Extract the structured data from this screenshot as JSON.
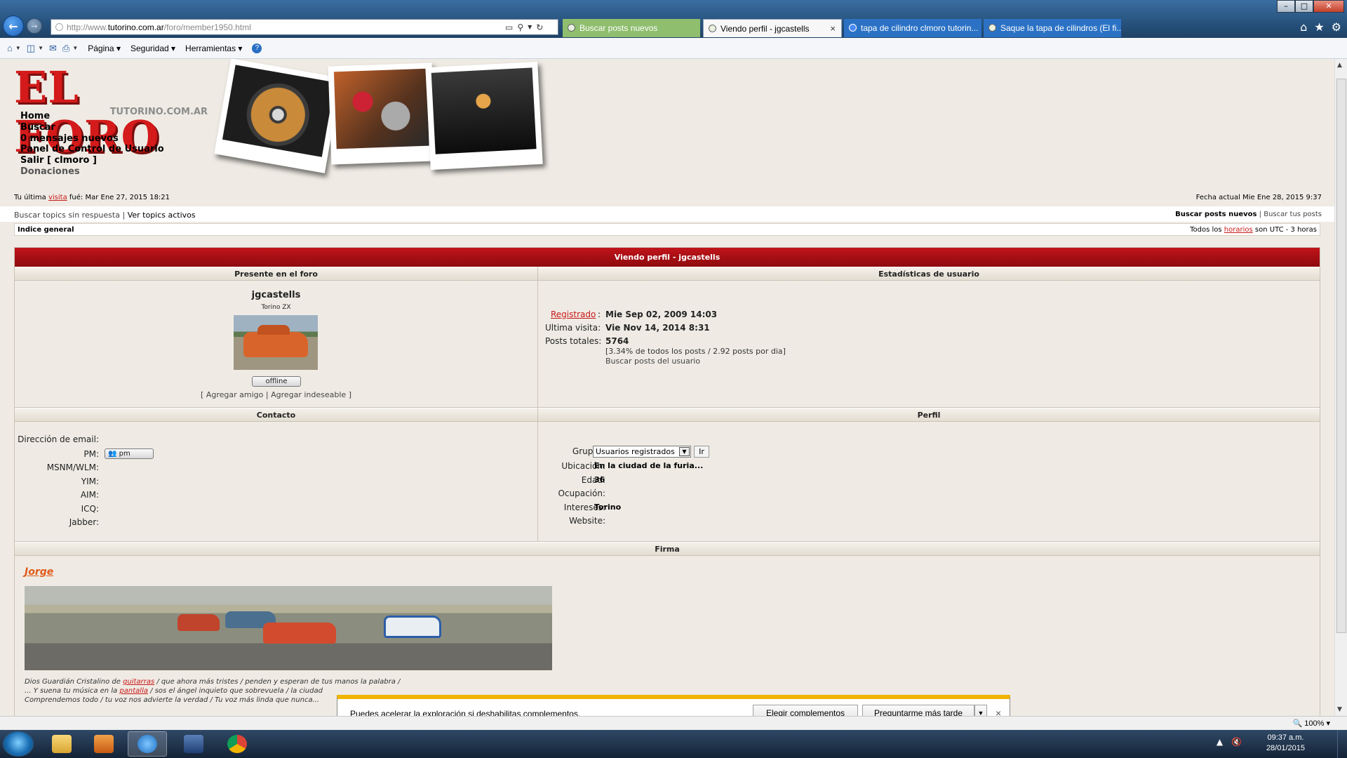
{
  "browser": {
    "address": {
      "prefix": "http://www.",
      "domain": "tutorino.com.ar",
      "path": "/foro/member1950.html"
    },
    "tabs": [
      {
        "label": "Buscar posts nuevos"
      },
      {
        "label": "Viendo perfil - jgcastells",
        "close": "×"
      },
      {
        "label": "tapa de cilindro clmoro tutorin..."
      },
      {
        "label": "Saque la tapa de cilindros (El fi..."
      }
    ],
    "command_bar": {
      "page": "Página",
      "safety": "Seguridad",
      "tools": "Herramientas"
    },
    "window_buttons": {
      "minimize": "–",
      "maximize": "□",
      "close": "✕"
    },
    "zoom": "100%"
  },
  "site": {
    "logo_main": "EL FORO",
    "logo_sub": "TUTORINO.COM.AR",
    "nav": [
      "Home",
      "Buscar",
      "0 mensajes nuevos",
      "Panel de Control de Usuario",
      "Salir [ clmoro ]",
      "Donaciones"
    ],
    "last_visit_prefix": "Tu última",
    "last_visit_link": "visita",
    "last_visit_suffix": "fué: Mar Ene 27, 2015 18:21",
    "current_date": "Fecha actual Mie Ene 28, 2015 9:37",
    "links_left_1": "Buscar topics sin respuesta",
    "links_sep": "|",
    "links_left_2": "Ver topics activos",
    "links_right_1": "Buscar posts nuevos",
    "links_right_2": "Buscar tus posts",
    "index_label": "Indice general",
    "tz_prefix": "Todos los",
    "tz_link": "horarios",
    "tz_suffix": "son UTC - 3 horas"
  },
  "profile": {
    "header": "Viendo perfil - jgcastells",
    "sections": {
      "present": "Presente en el foro",
      "stats": "Estadísticas de usuario",
      "contact": "Contacto",
      "profile": "Perfil",
      "signature": "Firma"
    },
    "username": "jgcastells",
    "rank": "Torino ZX",
    "status_badge": "offline",
    "friend_links": {
      "open": "[",
      "add_friend": "Agregar amigo",
      "sep": "|",
      "add_foe": "Agregar indeseable",
      "close": "]"
    },
    "stats": {
      "registered_label": "Registrado",
      "registered_value": "Mie Sep 02, 2009 14:03",
      "last_visit_label": "Ultima visita:",
      "last_visit_value": "Vie Nov 14, 2014 8:31",
      "posts_label": "Posts totales:",
      "posts_value": "5764",
      "posts_detail": "[3.34% de todos los posts / 2.92 posts por dia]",
      "search_posts": "Buscar posts del usuario"
    },
    "contact": {
      "labels": [
        "Dirección de email:",
        "PM:",
        "MSNM/WLM:",
        "YIM:",
        "AIM:",
        "ICQ:",
        "Jabber:"
      ],
      "pm_button": "pm"
    },
    "profile_fields": {
      "groups_label": "Grupos:",
      "groups_value": "Usuarios registrados",
      "groups_go": "Ir",
      "location_label": "Ubicación:",
      "location_value": "En la ciudad de la furia...",
      "age_label": "Edad:",
      "age_value": "36",
      "occupation_label": "Ocupación:",
      "interests_label": "Intereses:",
      "interests_value": "Torino",
      "website_label": "Website:"
    },
    "signature": {
      "name": "Jorge",
      "line1_a": "Dios Guardián Cristalino de",
      "line1_link": "guitarras",
      "line1_b": "/ que ahora más tristes / penden y esperan de tus manos la palabra /",
      "line2_a": "... Y suena tu música en la",
      "line2_link": "pantalla",
      "line2_b": "/ sos el ángel inquieto que sobrevuela / la ciudad",
      "line3": "Comprendemos todo / tu voz nos advierte la verdad / Tu voz más linda que nunca..."
    }
  },
  "notification": {
    "message": "Puedes acelerar la exploración si deshabilitas complementos.",
    "choose": "Elegir complementos",
    "later": "Preguntarme más tarde",
    "close": "×"
  },
  "taskbar": {
    "time": "09:37 a.m.",
    "date": "28/01/2015"
  }
}
